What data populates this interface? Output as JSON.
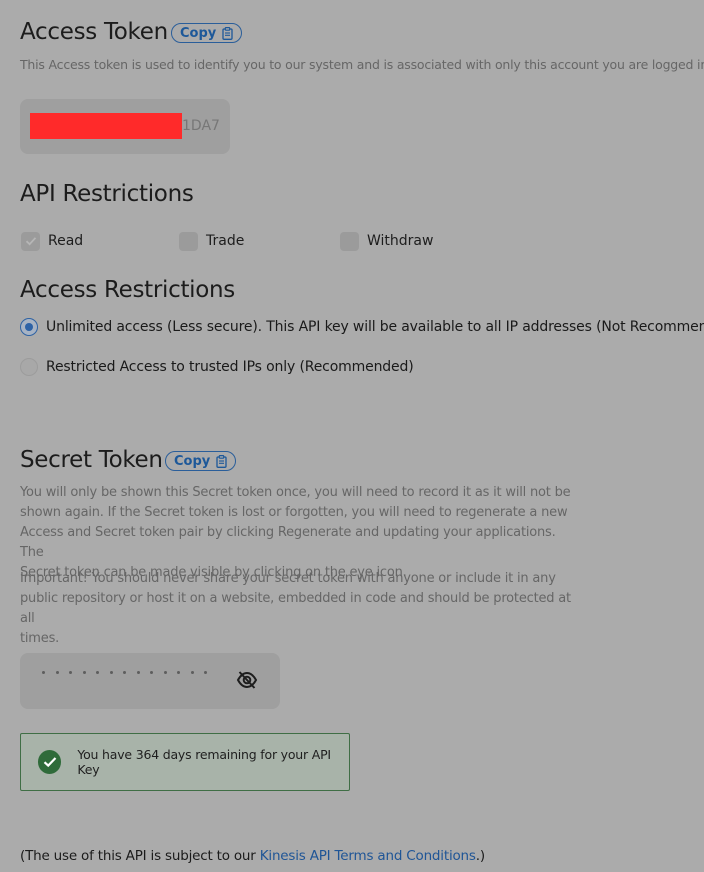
{
  "access_token": {
    "title": "Access Token",
    "copy_label": "Copy",
    "description": "This Access token is used to identify you to our system and is associated with only this account you are logged into.",
    "token_visible_tail": "1DA7"
  },
  "api_restrictions": {
    "title": "API Restrictions",
    "options": [
      {
        "label": "Read",
        "checked": true
      },
      {
        "label": "Trade",
        "checked": false
      },
      {
        "label": "Withdraw",
        "checked": false
      }
    ]
  },
  "access_restrictions": {
    "title": "Access Restrictions",
    "options": [
      {
        "label": "Unlimited access (Less secure). This API key will be available to all IP addresses (Not Recommended)",
        "selected": true
      },
      {
        "label": "Restricted Access to trusted IPs only (Recommended)",
        "selected": false
      }
    ]
  },
  "secret_token": {
    "title": "Secret Token",
    "copy_label": "Copy",
    "description_lines": [
      "You will only be shown this Secret token once, you will need to record it as it will not be",
      "shown again. If the Secret token is lost or forgotten, you will need to regenerate a new",
      "Access and Secret token pair by clicking Regenerate and updating your applications. The",
      "Secret token can be made visible by clicking on the eye icon."
    ],
    "warning_lines": [
      "Important! You should never share your secret token with anyone or include it in any",
      "public repository or host it on a website, embedded in code and should be protected at all",
      "times."
    ],
    "masked_dots": 13,
    "visibility_icon": "eye-off-icon"
  },
  "notice": {
    "icon": "check-circle-icon",
    "text": "You have 364 days remaining for your API Key",
    "color": "#2f6b3a"
  },
  "footer": {
    "prefix": "(The use of this API is subject to our ",
    "link_text": "Kinesis API Terms and Conditions",
    "suffix": ".)"
  },
  "colors": {
    "background": "#ababab",
    "accent": "#1f5596",
    "redaction": "#ff2a2a"
  }
}
